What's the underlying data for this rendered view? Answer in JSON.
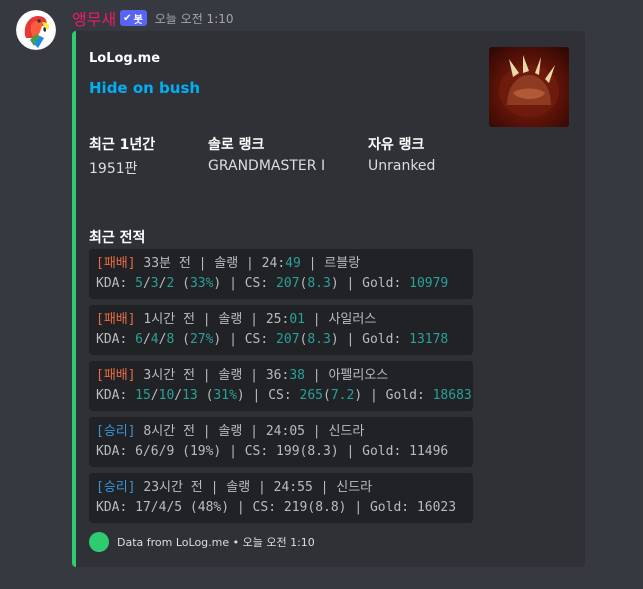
{
  "message": {
    "username": "앵무새",
    "bot_badge": "봇",
    "timestamp": "오늘 오전 1:10",
    "avatar_icon": "parrot-icon"
  },
  "embed": {
    "color": "#2ecc71",
    "provider": "LoLog.me",
    "title": "Hide on bush",
    "thumbnail_icon": "champion-claw-icon",
    "fields": [
      {
        "name": "최근 1년간",
        "value": "1951판"
      },
      {
        "name": "솔로 랭크",
        "value": "GRANDMASTER I"
      },
      {
        "name": "자유 랭크",
        "value": "Unranked"
      }
    ],
    "recent_title": "최근 전적",
    "matches": [
      {
        "result": "[패배]",
        "outcome": "lose",
        "when": "33분 전",
        "queue": "솔랭",
        "dur_min": "24",
        "dur_sec": "49",
        "champ": "르블랑",
        "k": "5",
        "d": "3",
        "a": "2",
        "kda_pct": "33%",
        "cs": "207",
        "cs_per_min": "8.3",
        "gold": "10979"
      },
      {
        "result": "[패배]",
        "outcome": "lose",
        "when": "1시간 전",
        "queue": "솔랭",
        "dur_min": "25",
        "dur_sec": "01",
        "champ": "사일러스",
        "k": "6",
        "d": "4",
        "a": "8",
        "kda_pct": "27%",
        "cs": "207",
        "cs_per_min": "8.3",
        "gold": "13178"
      },
      {
        "result": "[패배]",
        "outcome": "lose",
        "when": "3시간 전",
        "queue": "솔랭",
        "dur_min": "36",
        "dur_sec": "38",
        "champ": "아펠리오스",
        "k": "15",
        "d": "10",
        "a": "13",
        "kda_pct": "31%",
        "cs": "265",
        "cs_per_min": "7.2",
        "gold": "18683"
      },
      {
        "result": "[승리]",
        "outcome": "win",
        "when": "8시간 전",
        "queue": "솔랭",
        "dur_min": "24",
        "dur_sec": "05",
        "champ": "신드라",
        "k": "6",
        "d": "6",
        "a": "9",
        "kda_pct": "19%",
        "cs": "199",
        "cs_per_min": "8.3",
        "gold": "11496"
      },
      {
        "result": "[승리]",
        "outcome": "win",
        "when": "23시간 전",
        "queue": "솔랭",
        "dur_min": "24",
        "dur_sec": "55",
        "champ": "신드라",
        "k": "17",
        "d": "4",
        "a": "5",
        "kda_pct": "48%",
        "cs": "219",
        "cs_per_min": "8.8",
        "gold": "16023"
      }
    ],
    "footer_text": "Data from LoLog.me • 오늘 오전 1:10"
  }
}
